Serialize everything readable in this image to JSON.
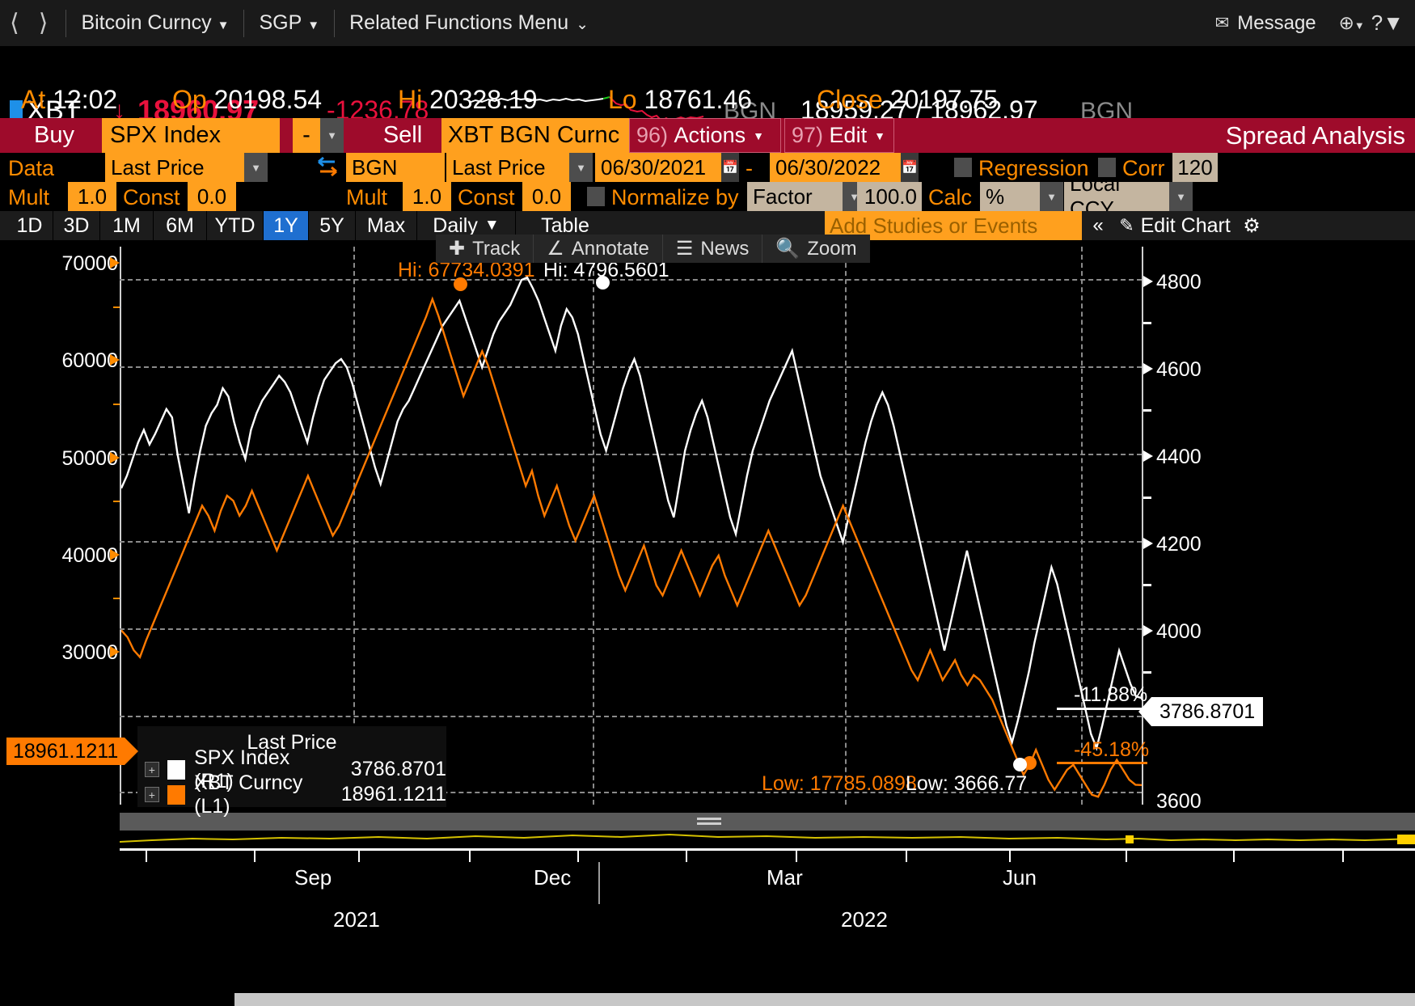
{
  "topnav": {
    "back_icon": "chevron-left-icon",
    "forward_icon": "chevron-right-icon",
    "security_label": "Bitcoin Curncy",
    "region_label": "SGP",
    "related_label": "Related Functions Menu",
    "message_label": "Message",
    "help_label": "?"
  },
  "quote": {
    "ticker": "XBT",
    "arrow": "↓",
    "last": "18960.97",
    "change": "-1236.78",
    "source_left": "BGN",
    "bid_ask": "18959.27 / 18962.97",
    "source_right": "BGN",
    "at_label": "At",
    "at_value": "12:02",
    "open_label": "Op",
    "open_value": "20198.54",
    "high_label": "Hi",
    "high_value": "20328.19",
    "low_label": "Lo",
    "low_value": "18761.46",
    "close_label": "Close",
    "close_value": "20197.75"
  },
  "actionbar": {
    "buy": "Buy",
    "security1": "SPX Index",
    "operator": "-",
    "sell": "Sell",
    "security2": "XBT BGN Curnc",
    "actions_num": "96)",
    "actions_label": "Actions",
    "edit_num": "97)",
    "edit_label": "Edit",
    "title": "Spread Analysis"
  },
  "datarow": {
    "data_label": "Data",
    "field1": "Last Price",
    "swap_icon": "swap-arrows-icon",
    "source": "BGN",
    "field2": "Last Price",
    "date_from": "06/30/2021",
    "date_dash": "-",
    "date_to": "06/30/2022",
    "regression_label": "Regression",
    "corr_label": "Corr",
    "corr_value": "120"
  },
  "multrow": {
    "mult1_label": "Mult",
    "mult1_value": "1.0",
    "const1_label": "Const",
    "const1_value": "0.0",
    "mult2_label": "Mult",
    "mult2_value": "1.0",
    "const2_label": "Const",
    "const2_value": "0.0",
    "normalize_label": "Normalize by",
    "factor_value": "Factor",
    "factor_number": "100.0",
    "calc_label": "Calc",
    "calc_value": "%",
    "ccy_value": "Local CCY"
  },
  "tabs": {
    "items": [
      {
        "label": "1D",
        "active": false
      },
      {
        "label": "3D",
        "active": false
      },
      {
        "label": "1M",
        "active": false
      },
      {
        "label": "6M",
        "active": false
      },
      {
        "label": "YTD",
        "active": false
      },
      {
        "label": "1Y",
        "active": true
      },
      {
        "label": "5Y",
        "active": false
      },
      {
        "label": "Max",
        "active": false
      }
    ],
    "frequency": "Daily",
    "table": "Table",
    "add_studies": "Add Studies or Events",
    "collapse_icon": "«",
    "edit_chart": "Edit Chart",
    "gear_icon": "gear-icon"
  },
  "charttools": {
    "track": "Track",
    "annotate": "Annotate",
    "news": "News",
    "zoom": "Zoom"
  },
  "chart_data": {
    "type": "line",
    "title": "Spread Analysis",
    "xlabel": "",
    "ylabel": "",
    "grid": true,
    "legend_position": "inside-bottom-left",
    "legend_title": "Last Price",
    "left_axis": {
      "label": "XBT Curncy (L1)",
      "ticks": [
        "30000",
        "40000",
        "50000",
        "60000",
        "70000"
      ],
      "tick_values": [
        30000,
        40000,
        50000,
        60000,
        70000
      ],
      "ylim": [
        17000,
        73000
      ],
      "color": "#ff7a00"
    },
    "right_axis": {
      "label": "SPX Index (R1)",
      "ticks": [
        "3600",
        "4000",
        "4200",
        "4400",
        "4600",
        "4800"
      ],
      "tick_values": [
        3600,
        4000,
        4200,
        4400,
        4600,
        4800
      ],
      "ylim": [
        3530,
        4870
      ],
      "color": "#ffffff"
    },
    "x_ticks": [
      "Sep",
      "Dec",
      "Mar",
      "Jun"
    ],
    "x_years": [
      "2021",
      "2022"
    ],
    "date_range": "06/30/2021 - 06/30/2022",
    "annotations": {
      "xbt_high": "Hi: 67734.0391",
      "spx_high": "Hi: 4796.5601",
      "xbt_low": "Low: 17785.0898",
      "spx_low": "Low: 3666.77",
      "spx_pct": "-11.88%",
      "xbt_pct": "-45.18%",
      "spx_last_flag": "3786.8701",
      "xbt_last_flag": "18961.1211"
    },
    "series": [
      {
        "name": "SPX Index",
        "axis": "R1",
        "color": "#ffffff",
        "last_value": "3786.8701",
        "high": 4796.5601,
        "low": 3666.77,
        "pct_change": "-11.88%",
        "values": [
          4290,
          4320,
          4360,
          4400,
          4430,
          4395,
          4420,
          4450,
          4480,
          4460,
          4370,
          4300,
          4230,
          4310,
          4380,
          4440,
          4470,
          4490,
          4530,
          4510,
          4450,
          4400,
          4360,
          4430,
          4470,
          4500,
          4520,
          4540,
          4560,
          4545,
          4520,
          4480,
          4440,
          4400,
          4460,
          4510,
          4550,
          4570,
          4590,
          4600,
          4580,
          4540,
          4490,
          4440,
          4390,
          4340,
          4300,
          4350,
          4400,
          4450,
          4480,
          4500,
          4530,
          4560,
          4590,
          4620,
          4650,
          4680,
          4700,
          4720,
          4740,
          4700,
          4660,
          4620,
          4580,
          4620,
          4660,
          4690,
          4710,
          4730,
          4760,
          4790,
          4796,
          4770,
          4740,
          4700,
          4660,
          4620,
          4680,
          4720,
          4700,
          4660,
          4600,
          4540,
          4480,
          4420,
          4380,
          4430,
          4480,
          4530,
          4570,
          4600,
          4560,
          4500,
          4440,
          4380,
          4320,
          4260,
          4220,
          4300,
          4380,
          4430,
          4470,
          4500,
          4460,
          4400,
          4340,
          4280,
          4220,
          4180,
          4250,
          4320,
          4380,
          4420,
          4460,
          4500,
          4530,
          4560,
          4590,
          4620,
          4560,
          4500,
          4440,
          4380,
          4320,
          4280,
          4240,
          4200,
          4160,
          4220,
          4280,
          4340,
          4400,
          4450,
          4490,
          4520,
          4490,
          4440,
          4380,
          4320,
          4260,
          4200,
          4140,
          4080,
          4020,
          3960,
          3900,
          3960,
          4020,
          4080,
          4140,
          4080,
          4020,
          3960,
          3900,
          3840,
          3780,
          3720,
          3680,
          3730,
          3790,
          3850,
          3920,
          3980,
          4040,
          4100,
          4060,
          4000,
          3940,
          3880,
          3820,
          3760,
          3700,
          3666,
          3720,
          3780,
          3840,
          3900,
          3860,
          3820,
          3790,
          3786
        ]
      },
      {
        "name": "XBT Curncy",
        "axis": "L1",
        "color": "#ff7a00",
        "last_value": "18961.1211",
        "high": 67734.0391,
        "low": 17785.0898,
        "pct_change": "-45.18%",
        "values": [
          34500,
          33800,
          32500,
          31800,
          33500,
          35000,
          36500,
          38000,
          39500,
          41000,
          42500,
          44000,
          45500,
          47000,
          46000,
          44500,
          46500,
          48000,
          47500,
          46000,
          47000,
          48500,
          47000,
          45500,
          44000,
          42500,
          44000,
          45500,
          47000,
          48500,
          50000,
          48500,
          47000,
          45500,
          44000,
          45000,
          46500,
          48000,
          49500,
          51000,
          52500,
          54000,
          55500,
          57000,
          58500,
          60000,
          61500,
          63000,
          64500,
          66000,
          67734,
          66000,
          64000,
          62000,
          60000,
          58000,
          59500,
          61000,
          62500,
          61000,
          59000,
          57000,
          55000,
          53000,
          51000,
          49000,
          50500,
          48000,
          46000,
          47500,
          49000,
          47000,
          45000,
          43500,
          45000,
          46500,
          48000,
          46000,
          44000,
          42000,
          40000,
          38500,
          40000,
          41500,
          43000,
          41000,
          39000,
          38000,
          39500,
          41000,
          42500,
          41000,
          39500,
          38000,
          39500,
          41000,
          42000,
          40000,
          38500,
          37000,
          38500,
          40000,
          41500,
          43000,
          44500,
          43000,
          41500,
          40000,
          38500,
          37000,
          38000,
          39500,
          41000,
          42500,
          44000,
          45500,
          47000,
          45500,
          44000,
          42500,
          41000,
          39500,
          38000,
          36500,
          35000,
          33500,
          32000,
          30500,
          29500,
          31000,
          32500,
          31000,
          29500,
          30500,
          31500,
          30000,
          29000,
          30000,
          29500,
          28500,
          27500,
          26000,
          24500,
          23000,
          21500,
          20000,
          21000,
          22500,
          21000,
          19500,
          18500,
          19500,
          20500,
          21000,
          20000,
          19000,
          18000,
          17785,
          19000,
          20500,
          21500,
          20500,
          19500,
          19000,
          18961
        ]
      }
    ]
  }
}
